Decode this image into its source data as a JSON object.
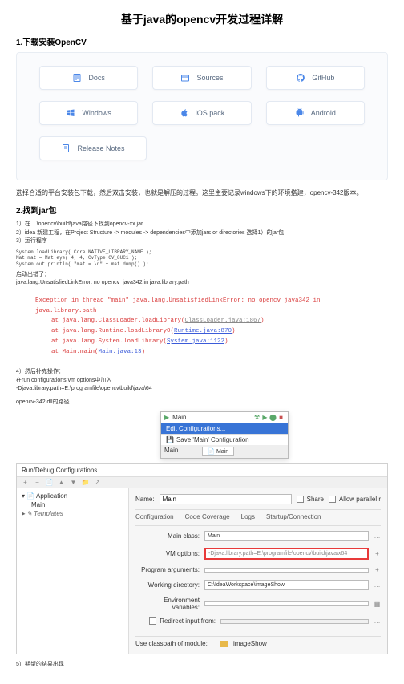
{
  "title": "基于java的opencv开发过程详解",
  "h1": "1.下载安装OpenCV",
  "download": {
    "docs": "Docs",
    "sources": "Sources",
    "github": "GitHub",
    "windows": "Windows",
    "ios": "iOS pack",
    "android": "Android",
    "release": "Release Notes"
  },
  "note1": "选择合适的平台安装包下载，然后双击安装，也就是解压的过程。这里主要记录windows下的环境搭建，opencv-342版本。",
  "h2": "2.找到jar包",
  "list1_1": "1）在 ...\\opencv\\build\\java路径下找到opencv-xx.jar",
  "list1_2": "2）idea 新建工程，在Project Structure -> modules -> dependencies中添加jars or directories 选择1）的jar包",
  "list1_3": "3）运行程序",
  "code1_1": "System.loadLibrary( Core.NATIVE_LIBRARY_NAME );",
  "code1_2": "    Mat mat = Mat.eye( 4, 4, CvType.CV_8UC1 );",
  "code1_3": "    System.out.println( \"mat = \\n\" + mat.dump() );",
  "startup_err_label": "启动出错了：",
  "startup_err": "java.lang.UnsatisfiedLinkError: no opencv_java342 in java.library.path",
  "err": {
    "l1": "Exception in thread \"main\" java.lang.UnsatisfiedLinkError: no opencv_java342 in java.library.path",
    "l2a": "at java.lang.ClassLoader.loadLibrary(",
    "l2b": "ClassLoader.java:1867",
    "l3a": "at java.lang.Runtime.loadLibrary0(",
    "l3b": "Runtime.java:870",
    "l4a": "at java.lang.System.loadLibrary(",
    "l4b": "System.java:1122",
    "l5a": "at Main.main(",
    "l5b": "Main.java:13"
  },
  "list2_1": "4）然后补充操作：",
  "list2_2": "在run configurations vm options中加入",
  "list2_3": "-Djava.library.path=E:\\programfile\\opencv\\build\\java\\64",
  "list2_4": "opencv-342.dll的路径",
  "menu": {
    "main": "Main",
    "edit": "Edit Configurations...",
    "save": "Save 'Main' Configuration",
    "main2": "Main",
    "main3": "Main"
  },
  "config": {
    "title": "Run/Debug Configurations",
    "tree_app": "Application",
    "tree_main": "Main",
    "tree_templates": "Templates",
    "name_label": "Name:",
    "name_value": "Main",
    "share": "Share",
    "allow": "Allow parallel r",
    "tabs": {
      "t1": "Configuration",
      "t2": "Code Coverage",
      "t3": "Logs",
      "t4": "Startup/Connection"
    },
    "main_class_label": "Main class:",
    "main_class_value": "Main",
    "vm_label": "VM options:",
    "vm_value": "-Djava.library.path=E:\\programfile\\opencv\\build\\java\\x64",
    "prog_args_label": "Program arguments:",
    "workdir_label": "Working directory:",
    "workdir_value": "C:\\IdeaWorkspace\\imageShow",
    "env_label": "Environment variables:",
    "redirect": "Redirect input from:",
    "classpath_label": "Use classpath of module:",
    "classpath_value": "imageShow"
  },
  "list3_1": "5）期望的结果出现"
}
